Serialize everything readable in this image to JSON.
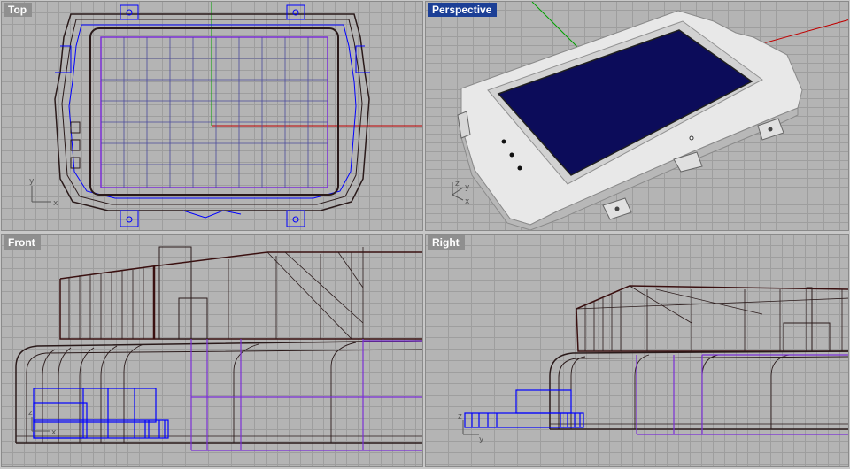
{
  "viewports": {
    "top": {
      "label": "Top",
      "axis_x": "x",
      "axis_y": "y"
    },
    "perspective": {
      "label": "Perspective",
      "axis_x": "x",
      "axis_y": "y",
      "axis_z": "z"
    },
    "front": {
      "label": "Front",
      "axis_x": "x",
      "axis_z": "z"
    },
    "right": {
      "label": "Right",
      "axis_y": "y",
      "axis_z": "z"
    }
  },
  "colors": {
    "viewport_bg": "#b4b4b4",
    "grid": "#9e9e9e",
    "active_tab": "#1c3f96",
    "inactive_tab": "#8f8f8f",
    "wire_blue": "#0000ff",
    "wire_purple": "#7b2fd6",
    "wire_dark": "#2a1a1a",
    "axis_red": "#c00000",
    "axis_green": "#00a000",
    "screen_navy": "#0c0c5a",
    "bezel": "#e6e6e6"
  },
  "icons": [
    "gizmo-axis-icon"
  ]
}
